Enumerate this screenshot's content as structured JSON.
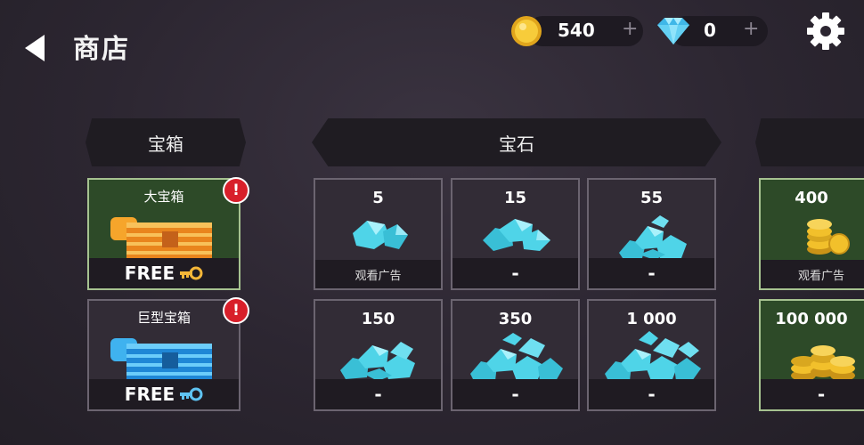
{
  "header": {
    "title": "商店",
    "coins": "540",
    "gems": "0",
    "plus": "+"
  },
  "sections": {
    "chests": "宝箱",
    "gems": "宝石"
  },
  "chests": [
    {
      "name": "大宝箱",
      "price": "FREE",
      "alert": "!",
      "color": "#f39a23"
    },
    {
      "name": "巨型宝箱",
      "price": "FREE",
      "alert": "!",
      "color": "#2f9fe6"
    }
  ],
  "gem_packs": [
    {
      "amount": "5",
      "action": "观看广告"
    },
    {
      "amount": "15",
      "action": "-"
    },
    {
      "amount": "55",
      "action": "-"
    },
    {
      "amount": "150",
      "action": "-"
    },
    {
      "amount": "350",
      "action": "-"
    },
    {
      "amount": "1 000",
      "action": "-"
    }
  ],
  "coin_packs": [
    {
      "amount": "400",
      "action": "观看广告"
    },
    {
      "amount": "100 000",
      "action": "-"
    }
  ],
  "colors": {
    "gem": "#4fd4e8",
    "coin": "#f2c02b",
    "alert": "#d81f2a",
    "green_card": "#2d4a28"
  }
}
